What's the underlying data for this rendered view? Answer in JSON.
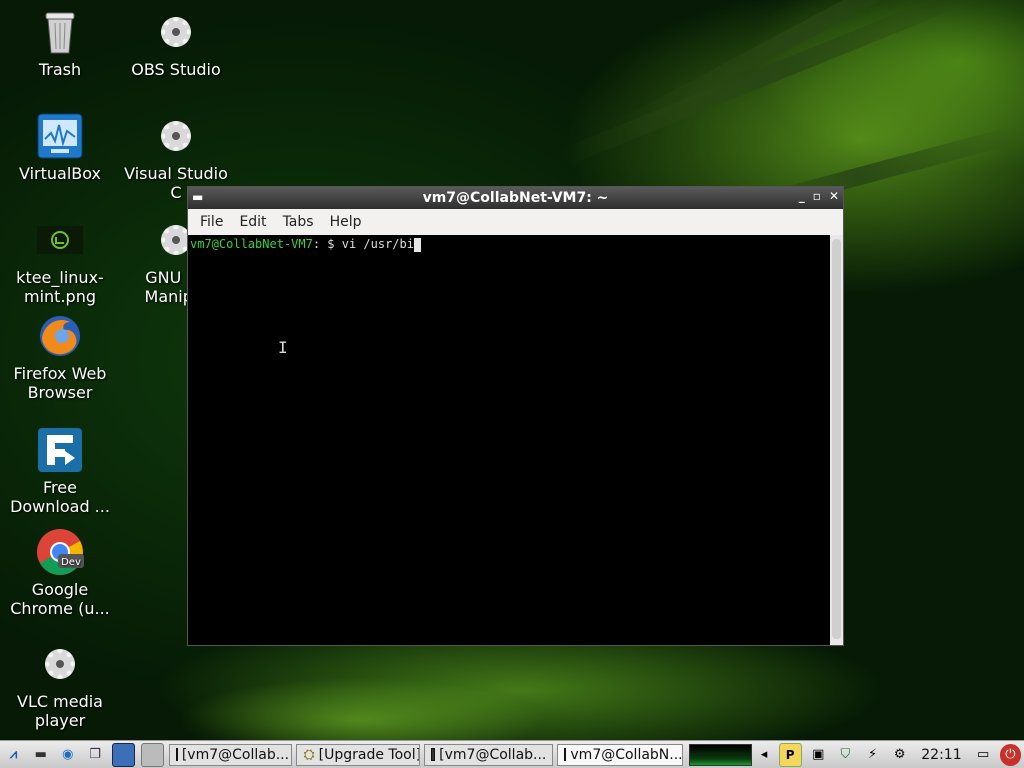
{
  "desktop": {
    "icons": [
      {
        "label": "Trash"
      },
      {
        "label": "OBS Studio"
      },
      {
        "label": "VirtualBox"
      },
      {
        "label": "Visual Studio C"
      },
      {
        "label": "ktee_linux-mint.png"
      },
      {
        "label": "GNU Im Manipul"
      },
      {
        "label": "Firefox Web Browser"
      },
      {
        "label": "Free Download ..."
      },
      {
        "label": "Google Chrome (u..."
      },
      {
        "label": "VLC media player"
      }
    ]
  },
  "terminal": {
    "title": "vm7@CollabNet-VM7: ~",
    "menu": [
      "File",
      "Edit",
      "Tabs",
      "Help"
    ],
    "prompt_user": "vm7@CollabNet-VM7",
    "prompt_rest": ": $ vi /usr/bi"
  },
  "taskbar": {
    "tasks": [
      {
        "label": "[vm7@Collab..."
      },
      {
        "label": "[Upgrade Tool]"
      },
      {
        "label": "[vm7@Collab..."
      },
      {
        "label": "vm7@CollabN..."
      }
    ],
    "clock": "22:11"
  },
  "colors": {
    "prompt_green": "#3cd03c",
    "desktop_green": "#7bd22a"
  }
}
